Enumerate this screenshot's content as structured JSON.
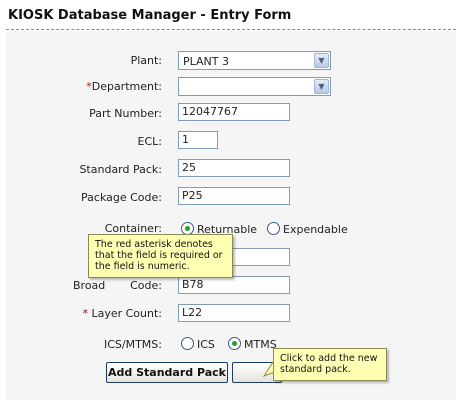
{
  "page": {
    "title": "KIOSK Database Manager - Entry Form"
  },
  "form": {
    "plant": {
      "label": "Plant:",
      "value": "PLANT 3"
    },
    "department": {
      "asterisk": "*",
      "label": "Department:",
      "value": ""
    },
    "part_number": {
      "label": "Part Number:",
      "value": "12047767"
    },
    "ecl": {
      "label": "ECL:",
      "value": "1"
    },
    "standard_pack": {
      "label": "Standard Pack:",
      "value": "25"
    },
    "package_code": {
      "label": "Package Code:",
      "value": "P25"
    },
    "container": {
      "label": "Container:",
      "options": [
        "Returnable",
        "Expendable"
      ],
      "selected": "Returnable"
    },
    "hidden_row": {
      "value": ""
    },
    "broadcast_code": {
      "label_visible": "Broad",
      "label_tail": "Code:",
      "value": "B78"
    },
    "layer_count": {
      "asterisk": "*",
      "label": "Layer Count:",
      "value": "L22"
    },
    "ics_mtms": {
      "label": "ICS/MTMS:",
      "options": [
        "ICS",
        "MTMS"
      ],
      "selected": "MTMS"
    },
    "buttons": {
      "add_label": "Add Standard Pack",
      "second_label": ""
    }
  },
  "callouts": {
    "asterisk_note": "The red asterisk denotes that the field is required or the field is numeric.",
    "add_note": "Click to add the new standard pack."
  },
  "colors": {
    "asterisk": "#d00000",
    "callout_bg": "#ffffb4",
    "title_rule": "#6b8ab6",
    "radio_dot": "#21a121"
  }
}
